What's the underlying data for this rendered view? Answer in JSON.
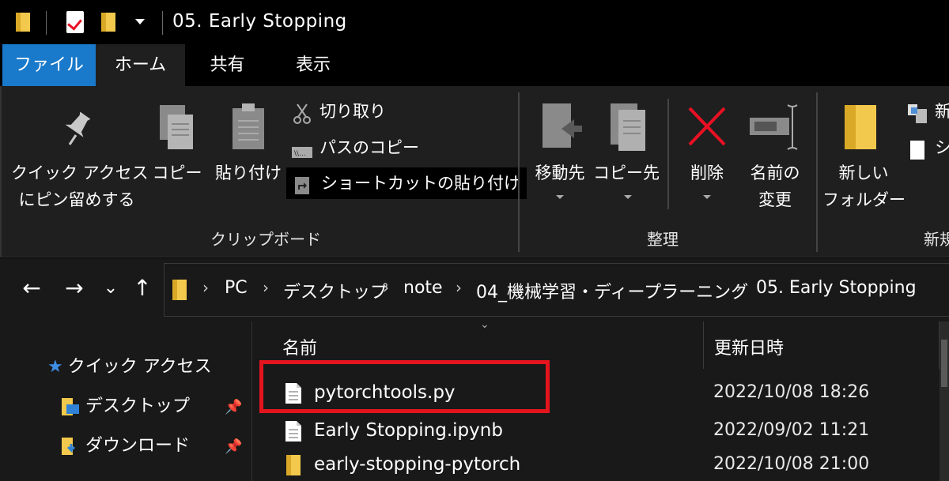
{
  "window": {
    "title": "05.  Early  Stopping"
  },
  "tabs": {
    "file": "ファイル",
    "home": "ホーム",
    "share": "共有",
    "view": "表示"
  },
  "ribbon": {
    "pin_quick_access_line1": "クイック アクセス",
    "pin_quick_access_line2": "にピン留めする",
    "copy": "コピー",
    "paste": "貼り付け",
    "cut": "切り取り",
    "copy_path": "パスのコピー",
    "paste_shortcut": "ショートカットの貼り付け",
    "group_clipboard": "クリップボード",
    "move_to": "移動先",
    "copy_to": "コピー先",
    "delete": "削除",
    "rename_line1": "名前の",
    "rename_line2": "変更",
    "group_organize": "整理",
    "new_folder_line1": "新しい",
    "new_folder_line2": "フォルダー",
    "new_item_partial": "新",
    "easy_access_partial": "シ",
    "group_new_partial": "新規"
  },
  "nav": {
    "back": "←",
    "forward": "→",
    "recent": "⌄",
    "up": "↑"
  },
  "breadcrumb": {
    "items": [
      "PC",
      "デスクトップ",
      "note",
      "04_機械学習・ディープラーニング",
      "05.  Early  Stopping"
    ]
  },
  "navpane": {
    "quick_access": "クイック アクセス",
    "desktop": "デスクトップ",
    "downloads": "ダウンロード"
  },
  "columns": {
    "name": "名前",
    "modified": "更新日時"
  },
  "files": [
    {
      "name": "pytorchtools.py",
      "modified": "2022/10/08 18:26",
      "type": "file"
    },
    {
      "name": "Early Stopping.ipynb",
      "modified": "2022/09/02 11:21",
      "type": "file"
    },
    {
      "name": "early-stopping-pytorch",
      "modified": "2022/10/08 21:00",
      "type": "folder"
    }
  ],
  "colors": {
    "file_tab": "#1979ca",
    "highlight_box": "#e3141d",
    "delete_x": "#e81123",
    "folder": "#f2c94c"
  }
}
